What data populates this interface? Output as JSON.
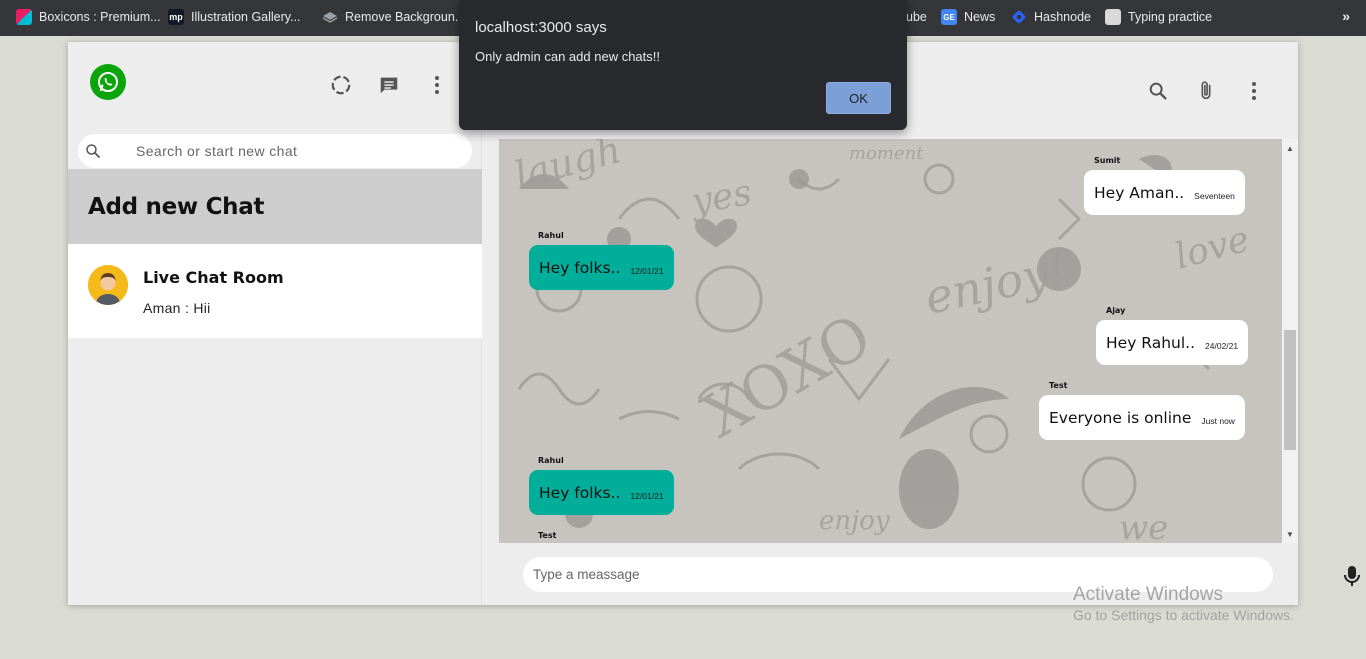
{
  "bookmarks": [
    {
      "label": "Boxicons : Premium...",
      "icon": "boxicons-icon",
      "color": "#e91e63"
    },
    {
      "label": "Illustration Gallery...",
      "icon": "mp-icon",
      "color": "#1a1a2e"
    },
    {
      "label": "Remove Backgroun...",
      "icon": "removebg-icon",
      "color": "#9aa0a6"
    },
    {
      "label": "ube",
      "icon": "",
      "color": ""
    },
    {
      "label": "News",
      "icon": "google-news-icon",
      "color": "#4285f4"
    },
    {
      "label": "Hashnode",
      "icon": "hashnode-icon",
      "color": "#2962ff"
    },
    {
      "label": "Typing practice",
      "icon": "typing-icon",
      "color": "#cfcfcf"
    }
  ],
  "bookmarks_more": "»",
  "sidebar": {
    "search_placeholder": "Search or start new chat",
    "add_new_chat": "Add new Chat",
    "chats": [
      {
        "name": "Live Chat Room",
        "last_message": "Aman : Hii"
      }
    ]
  },
  "messages": [
    {
      "name": "Sumit",
      "text": "Hey Aman..",
      "time": "Seventeen",
      "side": "sent"
    },
    {
      "name": "Rahul",
      "text": "Hey folks..",
      "time": "12/01/21",
      "side": "recv"
    },
    {
      "name": "Ajay",
      "text": "Hey Rahul..",
      "time": "24/02/21",
      "side": "sent"
    },
    {
      "name": "Test",
      "text": "Everyone is online",
      "time": "Just now",
      "side": "sent"
    },
    {
      "name": "Rahul",
      "text": "Hey folks..",
      "time": "12/01/21",
      "side": "recv"
    },
    {
      "name": "Test",
      "text": "",
      "time": "",
      "side": "recv"
    }
  ],
  "footer": {
    "input_placeholder": "Type a meassage"
  },
  "alert": {
    "title": "localhost:3000 says",
    "message": "Only admin can add new chats!!",
    "ok_label": "OK"
  },
  "watermark": {
    "title": "Activate Windows",
    "subtitle": "Go to Settings to activate Windows."
  },
  "colors": {
    "whatsapp_green": "#0ba50b",
    "received_bubble": "#00ae9a",
    "sent_bubble": "#ffffff",
    "dialog_bg": "#292a2d",
    "dialog_button": "#7c9fd8"
  }
}
